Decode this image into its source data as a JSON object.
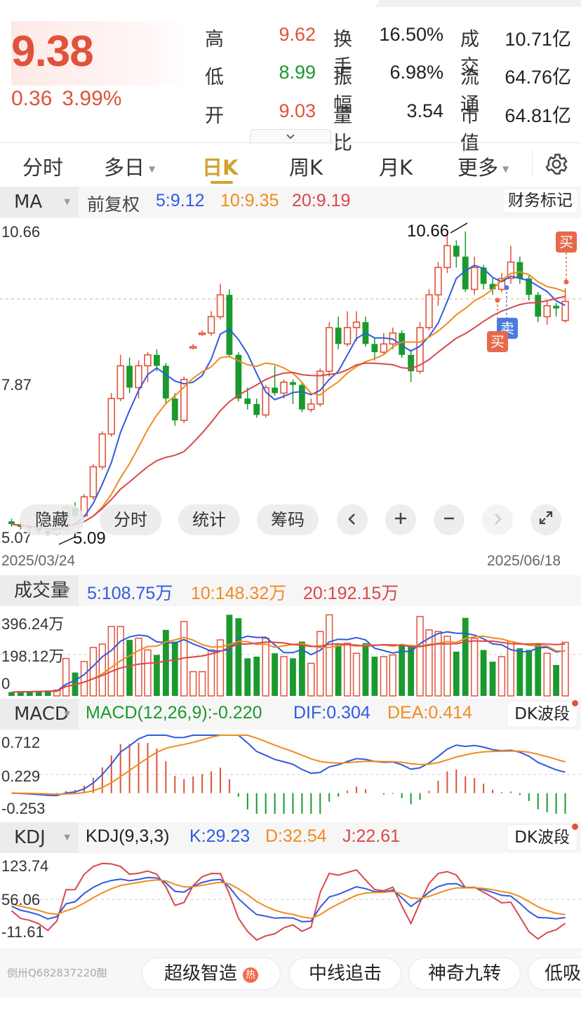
{
  "quote": {
    "price": "9.38",
    "change": "0.36",
    "change_pct": "3.99%",
    "stats": [
      {
        "label": "高",
        "value": "9.62",
        "color": "#e0523a"
      },
      {
        "label": "低",
        "value": "8.99",
        "color": "#1a9a2e"
      },
      {
        "label": "开",
        "value": "9.03",
        "color": "#e0523a"
      }
    ],
    "stats2": [
      {
        "label": "换手",
        "value": "16.50%"
      },
      {
        "label": "振幅",
        "value": "6.98%"
      },
      {
        "label": "量比",
        "value": "3.54"
      }
    ],
    "stats3": [
      {
        "label": "成交",
        "value": "10.71亿"
      },
      {
        "label": "流通",
        "value": "64.76亿"
      },
      {
        "label": "市值",
        "value": "64.81亿"
      }
    ],
    "collapse_icon": "chevron-down-icon"
  },
  "tabs": [
    {
      "label": "分时",
      "caret": ""
    },
    {
      "label": "多日",
      "caret": "▼"
    },
    {
      "label": "日K",
      "caret": "",
      "active": true
    },
    {
      "label": "周K",
      "caret": ""
    },
    {
      "label": "月K",
      "caret": ""
    },
    {
      "label": "更多",
      "caret": "▼"
    }
  ],
  "settings_icon": "gear-icon",
  "ma_row": {
    "name": "MA",
    "adjust": "前复权",
    "ma5": "5:9.12",
    "ma10": "10:9.35",
    "ma20": "20:9.19",
    "fin_marker": "财务标记"
  },
  "price_axis": {
    "high": "10.66",
    "mid": "7.87",
    "low": "5.07"
  },
  "annotations": {
    "high_label": "10.66",
    "low_label": "5.09",
    "buy": "买",
    "sell": "卖"
  },
  "dates": {
    "start": "2025/03/24",
    "end": "2025/06/18"
  },
  "chart_controls": {
    "hide": "隐藏",
    "intraday": "分时",
    "stats": "统计",
    "chips": "筹码",
    "prev_icon": "chevron-left-icon",
    "zoom_in_icon": "plus-icon",
    "zoom_out_icon": "minus-icon",
    "next_icon": "chevron-right-icon",
    "fullscreen_icon": "expand-icon"
  },
  "volume_row": {
    "name": "成交量",
    "ma5": "5:108.75万",
    "ma10": "10:148.32万",
    "ma20": "20:192.15万",
    "axis": [
      "396.24万",
      "198.12万",
      "0"
    ]
  },
  "macd_row": {
    "name": "MACD",
    "params": "MACD(12,26,9):-0.220",
    "dif": "DIF:0.304",
    "dea": "DEA:0.414",
    "dk": "DK波段",
    "axis": [
      "0.712",
      "0.229",
      "-0.253"
    ]
  },
  "kdj_row": {
    "name": "KDJ",
    "params": "KDJ(9,3,3)",
    "k": "K:29.23",
    "d": "D:32.54",
    "j": "J:22.61",
    "dk": "DK波段",
    "axis": [
      "123.74",
      "56.06",
      "-11.61"
    ]
  },
  "bottom": {
    "watermark": "倒卅Q682837220酣",
    "chips": [
      "超级智造",
      "中线追击",
      "神奇九转",
      "低吸"
    ],
    "hot": "热"
  },
  "chart_data": {
    "type": "candlestick",
    "ylim": [
      5.07,
      10.66
    ],
    "up_color": "#e0523a",
    "down_color": "#1a9a2e",
    "candles": [
      [
        5.35,
        5.3,
        5.4,
        5.25
      ],
      [
        5.3,
        5.25,
        5.35,
        5.2
      ],
      [
        5.25,
        5.22,
        5.3,
        5.15
      ],
      [
        5.22,
        5.18,
        5.28,
        5.12
      ],
      [
        5.18,
        5.12,
        5.22,
        5.09
      ],
      [
        5.12,
        5.2,
        5.25,
        5.09
      ],
      [
        5.2,
        5.6,
        5.65,
        5.18
      ],
      [
        5.6,
        5.45,
        5.7,
        5.4
      ],
      [
        5.45,
        5.8,
        5.85,
        5.42
      ],
      [
        5.8,
        6.35,
        6.4,
        5.75
      ],
      [
        6.35,
        6.95,
        7.0,
        6.3
      ],
      [
        6.95,
        7.6,
        7.7,
        6.9
      ],
      [
        7.6,
        8.2,
        8.4,
        7.55
      ],
      [
        8.2,
        7.8,
        8.35,
        7.7
      ],
      [
        7.8,
        8.2,
        8.3,
        7.6
      ],
      [
        8.2,
        8.4,
        8.45,
        7.9
      ],
      [
        8.4,
        8.2,
        8.5,
        8.1
      ],
      [
        8.2,
        7.6,
        8.25,
        7.5
      ],
      [
        7.6,
        7.2,
        7.7,
        7.1
      ],
      [
        7.2,
        7.95,
        8.0,
        7.15
      ],
      [
        8.55,
        8.55,
        8.6,
        8.5
      ],
      [
        8.8,
        8.8,
        8.85,
        8.75
      ],
      [
        8.8,
        9.1,
        9.2,
        8.75
      ],
      [
        9.1,
        9.5,
        9.7,
        9.05
      ],
      [
        9.5,
        8.4,
        9.6,
        8.35
      ],
      [
        8.4,
        7.6,
        8.45,
        7.55
      ],
      [
        7.6,
        7.5,
        7.8,
        7.4
      ],
      [
        7.5,
        7.3,
        7.6,
        7.25
      ],
      [
        7.3,
        7.8,
        7.85,
        7.25
      ],
      [
        7.8,
        7.7,
        8.2,
        7.65
      ],
      [
        7.7,
        7.9,
        7.95,
        7.6
      ],
      [
        7.9,
        7.85,
        7.95,
        7.5
      ],
      [
        7.85,
        7.4,
        7.9,
        7.35
      ],
      [
        7.4,
        7.5,
        7.6,
        7.35
      ],
      [
        7.5,
        8.1,
        8.15,
        7.45
      ],
      [
        8.1,
        8.9,
        9.0,
        8.0
      ],
      [
        8.9,
        8.6,
        9.1,
        8.5
      ],
      [
        8.6,
        8.9,
        9.2,
        8.55
      ],
      [
        8.9,
        9.0,
        9.2,
        8.65
      ],
      [
        9.0,
        8.6,
        9.1,
        8.55
      ],
      [
        8.6,
        8.45,
        8.7,
        8.3
      ],
      [
        8.45,
        8.6,
        8.8,
        8.4
      ],
      [
        8.6,
        8.8,
        8.9,
        8.5
      ],
      [
        8.8,
        8.4,
        8.85,
        8.35
      ],
      [
        8.4,
        8.1,
        8.5,
        7.9
      ],
      [
        8.1,
        8.9,
        9.0,
        8.05
      ],
      [
        8.9,
        9.5,
        9.6,
        8.85
      ],
      [
        9.5,
        10.0,
        10.1,
        9.3
      ],
      [
        10.0,
        10.4,
        10.66,
        9.9
      ],
      [
        10.4,
        10.2,
        10.5,
        10.0
      ],
      [
        10.2,
        9.6,
        10.66,
        9.55
      ],
      [
        9.6,
        10.0,
        10.2,
        9.5
      ],
      [
        10.0,
        9.7,
        10.05,
        9.6
      ],
      [
        9.7,
        9.6,
        9.8,
        9.5
      ],
      [
        9.6,
        9.8,
        9.9,
        9.55
      ],
      [
        9.8,
        10.1,
        10.4,
        9.7
      ],
      [
        10.1,
        9.8,
        10.2,
        9.7
      ],
      [
        9.8,
        9.5,
        9.85,
        9.4
      ],
      [
        9.5,
        9.1,
        9.55,
        9.0
      ],
      [
        9.1,
        9.3,
        9.4,
        8.95
      ],
      [
        9.3,
        9.25,
        9.35,
        9.1
      ],
      [
        9.03,
        9.38,
        9.62,
        8.99
      ]
    ],
    "volume_max": 396.24
  }
}
